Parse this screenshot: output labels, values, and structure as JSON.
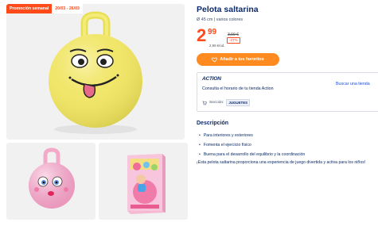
{
  "promo": {
    "label": "Promoción semanal",
    "dates": "20/03 - 26/03"
  },
  "gallery": {
    "main_alt": "Pelota saltarina amarilla con cara",
    "thumbs": [
      "Pelota saltarina rosa",
      "Caja del producto"
    ]
  },
  "product": {
    "title": "Pelota saltarina",
    "subtitle": "Ø 45 cm | varios colores",
    "price_int": "2",
    "price_cents": "99",
    "old_price": "3,99 €",
    "discount": "-27%",
    "unit_price": "2,99 €/ud.",
    "fav_label": "Añadir a tus favoritos"
  },
  "store": {
    "logo": "ACTION",
    "hours": "Consulta el horario de tu tienda Action",
    "find_store": "Buscar una tienda",
    "section_label": "Sección:",
    "section_value": "JUGUETES"
  },
  "description": {
    "title": "Descripción",
    "bullets": [
      "Para interiores y exteriores",
      "Fomenta el ejercicio físico",
      "Buena para el desarrollo del equilibrio y la coordinación"
    ],
    "text": "¡Esta pelota saltarina proporciona una experiencia de juego divertida y activa para los niños!"
  },
  "colors": {
    "accent": "#ff4a1a",
    "button": "#ff8a1f",
    "navy": "#0b2b6b",
    "link": "#1d4fd8"
  }
}
